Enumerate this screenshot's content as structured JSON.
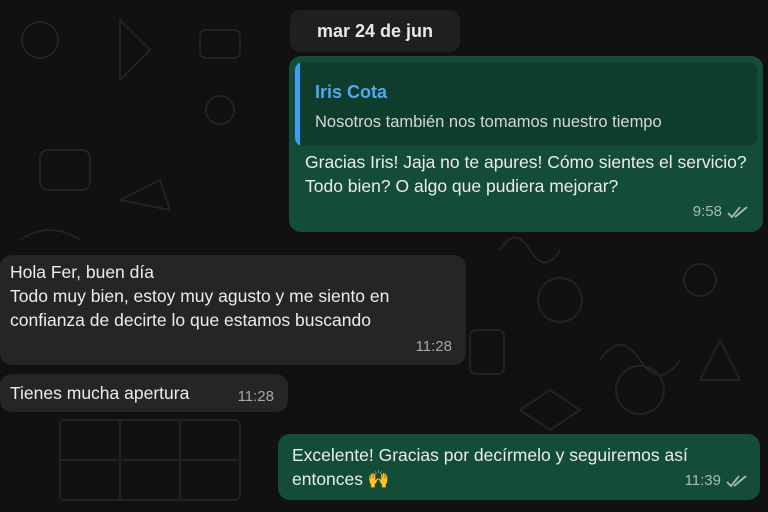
{
  "date_separator": "mar 24 de jun",
  "messages": [
    {
      "direction": "outgoing",
      "quote": {
        "author": "Iris Cota",
        "text": "Nosotros también nos tomamos nuestro tiempo"
      },
      "text": "Gracias Iris! Jaja no te apures! Cómo sientes el servicio? Todo bien? O algo que pudiera mejorar?",
      "time": "9:58",
      "status": "read-double-check"
    },
    {
      "direction": "incoming",
      "lines": [
        "Hola Fer, buen día",
        "Todo muy bien, estoy muy agusto y me siento en",
        "confianza de decirte lo que estamos buscando"
      ],
      "time": "11:28"
    },
    {
      "direction": "incoming",
      "text": "Tienes mucha apertura",
      "time": "11:28"
    },
    {
      "direction": "outgoing",
      "text": "Excelente! Gracias por decírmelo y seguiremos así entonces 🙌",
      "time": "11:39",
      "status": "read-double-check"
    }
  ],
  "colors": {
    "background": "#111111",
    "outgoing_bubble": "#144d37",
    "incoming_bubble": "#242626",
    "quote_accent": "#3e9ef2",
    "date_pill": "#1f1f1f"
  }
}
